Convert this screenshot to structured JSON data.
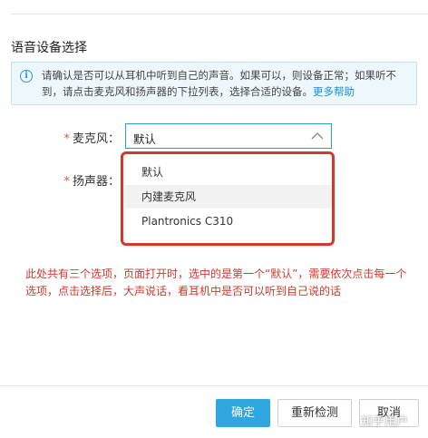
{
  "section_title": "语音设备选择",
  "info": {
    "text": "请确认是否可以从耳机中听到自己的声音。如果可以，则设备正常；如果听不到，请点击麦克风和扬声器的下拉列表，选择合适的设备。",
    "link": "更多帮助",
    "icon": "info-icon"
  },
  "form": {
    "required_mark": "*",
    "microphone_label": "麦克风：",
    "speaker_label": "扬声器：",
    "microphone_value": "默认",
    "options": [
      "默认",
      "内建麦克风",
      "Plantronics C310"
    ]
  },
  "annotation": "此处共有三个选项，页面打开时，选中的是第一个“默认”，需要依次点击每一个选项，点击选择后，大声说话，看耳机中是否可以听到自己说的话",
  "buttons": {
    "confirm": "确定",
    "redetect": "重新检测",
    "cancel": "取消"
  },
  "watermark": "知乎用户",
  "colors": {
    "accent": "#2fa7de",
    "annotation_red": "#cf3a2c",
    "link": "#1a8fd6"
  }
}
